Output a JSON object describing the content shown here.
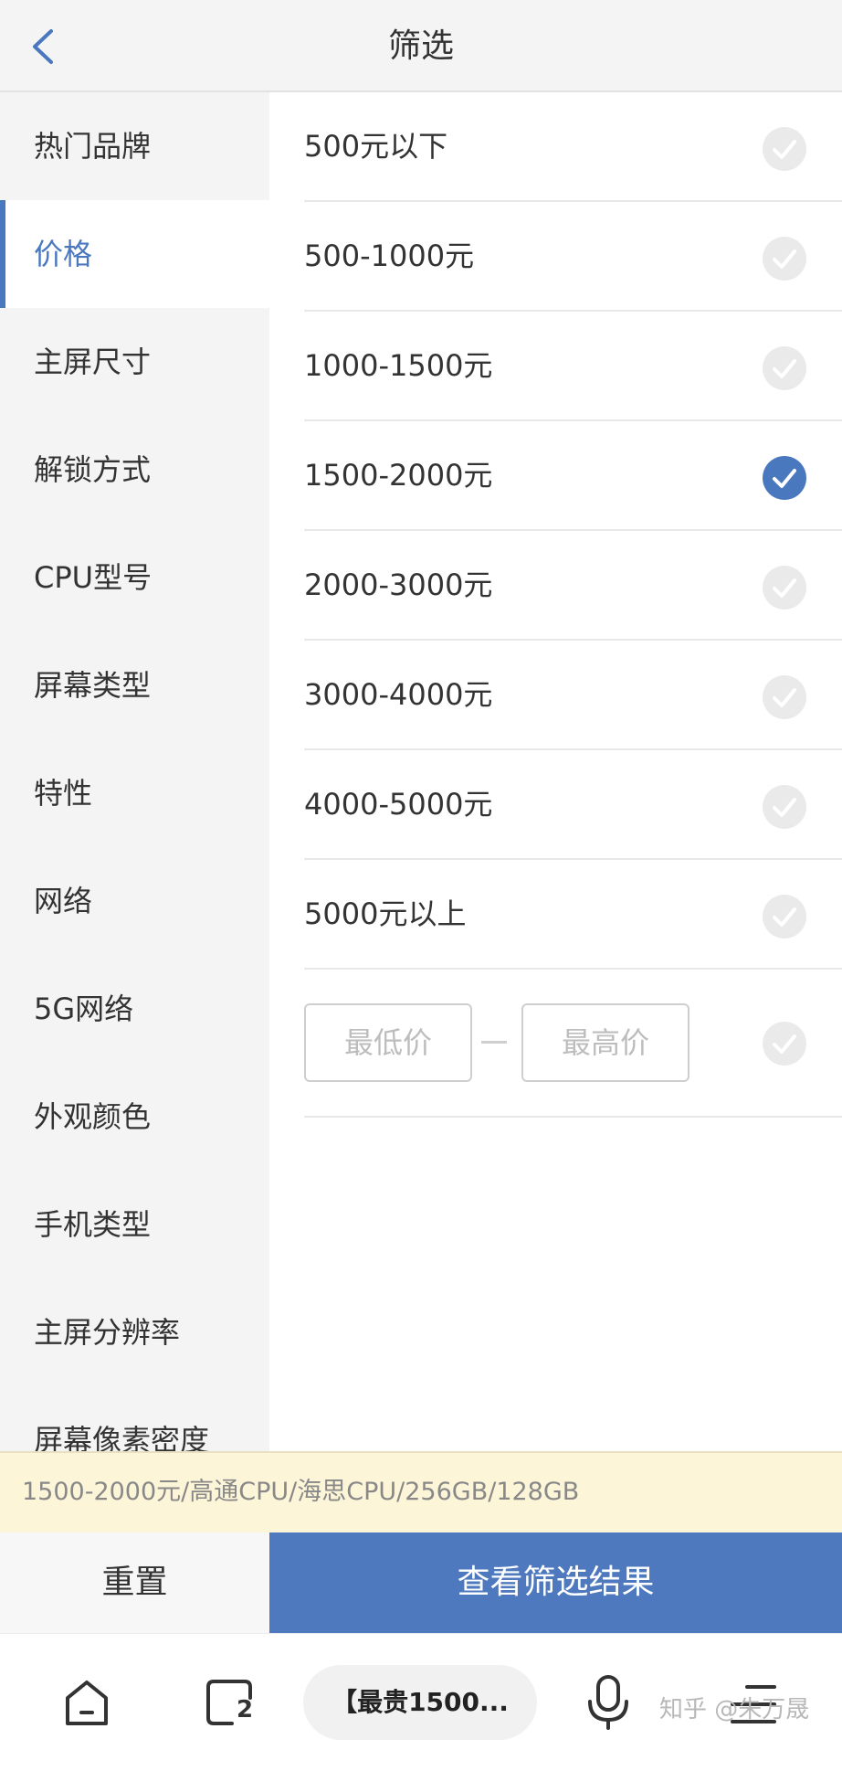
{
  "header": {
    "title": "筛选"
  },
  "sidebar": {
    "items": [
      {
        "label": "热门品牌",
        "active": false
      },
      {
        "label": "价格",
        "active": true
      },
      {
        "label": "主屏尺寸",
        "active": false
      },
      {
        "label": "解锁方式",
        "active": false
      },
      {
        "label": "CPU型号",
        "active": false
      },
      {
        "label": "屏幕类型",
        "active": false
      },
      {
        "label": "特性",
        "active": false
      },
      {
        "label": "网络",
        "active": false
      },
      {
        "label": "5G网络",
        "active": false
      },
      {
        "label": "外观颜色",
        "active": false
      },
      {
        "label": "手机类型",
        "active": false
      },
      {
        "label": "主屏分辨率",
        "active": false
      },
      {
        "label": "屏幕像素密度",
        "active": false
      }
    ]
  },
  "price_options": [
    {
      "label": "500元以下",
      "selected": false
    },
    {
      "label": "500-1000元",
      "selected": false
    },
    {
      "label": "1000-1500元",
      "selected": false
    },
    {
      "label": "1500-2000元",
      "selected": true
    },
    {
      "label": "2000-3000元",
      "selected": false
    },
    {
      "label": "3000-4000元",
      "selected": false
    },
    {
      "label": "4000-5000元",
      "selected": false
    },
    {
      "label": "5000元以上",
      "selected": false
    }
  ],
  "custom_range": {
    "min_placeholder": "最低价",
    "max_placeholder": "最高价",
    "min_value": "",
    "max_value": ""
  },
  "summary": {
    "text": "1500-2000元/高通CPU/海思CPU/256GB/128GB"
  },
  "actions": {
    "reset_label": "重置",
    "view_results_label": "查看筛选结果"
  },
  "browser_bar": {
    "address_text": "【最贵1500...",
    "tab_count": "2",
    "watermark": "知乎 @朱万晟"
  },
  "colors": {
    "accent": "#4e79be",
    "summary_bg": "#fdf5d8",
    "sidebar_bg": "#f4f4f4"
  },
  "icons": [
    "back-icon",
    "check-icon",
    "home-icon",
    "tabs-icon",
    "microphone-icon",
    "menu-icon"
  ]
}
